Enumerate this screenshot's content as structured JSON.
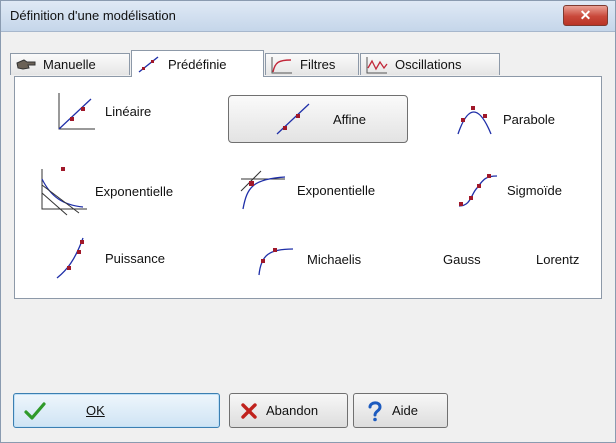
{
  "window": {
    "title": "Définition d'une modélisation",
    "close_glyph": "✕"
  },
  "tabs": [
    {
      "label": "Manuelle",
      "icon": "hand-icon",
      "active": false
    },
    {
      "label": "Prédéfinie",
      "icon": "line-curve-icon",
      "active": true
    },
    {
      "label": "Filtres",
      "icon": "filter-curve-icon",
      "active": false
    },
    {
      "label": "Oscillations",
      "icon": "oscillation-icon",
      "active": false
    }
  ],
  "models": [
    {
      "label": "Linéaire",
      "icon": "linear-through-origin-icon",
      "selected": false
    },
    {
      "label": "Affine",
      "icon": "affine-line-icon",
      "selected": true
    },
    {
      "label": "Parabole",
      "icon": "parabola-icon",
      "selected": false
    },
    {
      "label": "Exponentielle",
      "icon": "exponential-decay-icon",
      "selected": false
    },
    {
      "label": "Exponentielle",
      "icon": "exponential-rise-icon",
      "selected": false
    },
    {
      "label": "Sigmoïde",
      "icon": "sigmoid-icon",
      "selected": false
    },
    {
      "label": "Puissance",
      "icon": "power-curve-icon",
      "selected": false
    },
    {
      "label": "Michaelis",
      "icon": "michaelis-curve-icon",
      "selected": false
    },
    {
      "label": "Gauss",
      "icon": "",
      "selected": false
    },
    {
      "label": "Lorentz",
      "icon": "",
      "selected": false
    }
  ],
  "buttons": {
    "ok": {
      "label": "OK",
      "icon": "checkmark-icon"
    },
    "abandon": {
      "label": "Abandon",
      "icon": "red-x-icon"
    },
    "aide": {
      "label": "Aide",
      "icon": "question-mark-icon"
    }
  },
  "colors": {
    "curve_blue": "#1f2fa8",
    "point_red": "#a0182a",
    "close_red": "#c9483a",
    "ok_check": "#2f9a2a"
  }
}
